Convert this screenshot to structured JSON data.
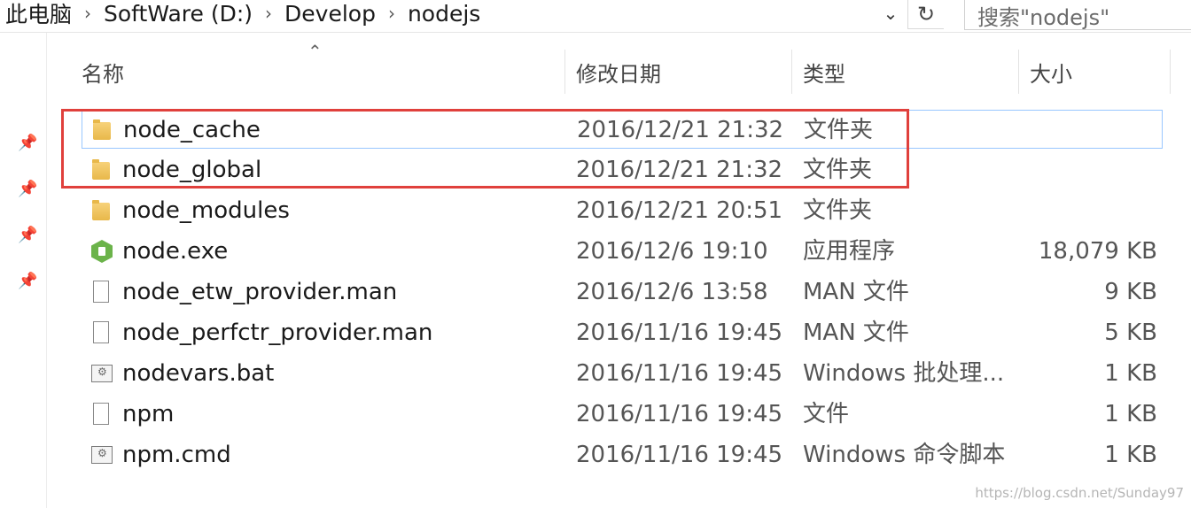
{
  "address_bar": {
    "crumbs": [
      "此电脑",
      "SoftWare (D:)",
      "Develop",
      "nodejs"
    ],
    "separator": "›"
  },
  "search": {
    "placeholder": "搜索\"nodejs\""
  },
  "columns": {
    "name": "名称",
    "date": "修改日期",
    "type": "类型",
    "size": "大小"
  },
  "files": [
    {
      "name": "node_cache",
      "date": "2016/12/21 21:32",
      "type": "文件夹",
      "size": "",
      "icon": "folder-icon"
    },
    {
      "name": "node_global",
      "date": "2016/12/21 21:32",
      "type": "文件夹",
      "size": "",
      "icon": "folder-icon"
    },
    {
      "name": "node_modules",
      "date": "2016/12/21 20:51",
      "type": "文件夹",
      "size": "",
      "icon": "folder-icon"
    },
    {
      "name": "node.exe",
      "date": "2016/12/6 19:10",
      "type": "应用程序",
      "size": "18,079 KB",
      "icon": "nodejs-app-icon"
    },
    {
      "name": "node_etw_provider.man",
      "date": "2016/12/6 13:58",
      "type": "MAN 文件",
      "size": "9 KB",
      "icon": "file-icon"
    },
    {
      "name": "node_perfctr_provider.man",
      "date": "2016/11/16 19:45",
      "type": "MAN 文件",
      "size": "5 KB",
      "icon": "file-icon"
    },
    {
      "name": "nodevars.bat",
      "date": "2016/11/16 19:45",
      "type": "Windows 批处理...",
      "size": "1 KB",
      "icon": "batch-file-icon"
    },
    {
      "name": "npm",
      "date": "2016/11/16 19:45",
      "type": "文件",
      "size": "1 KB",
      "icon": "file-icon"
    },
    {
      "name": "npm.cmd",
      "date": "2016/11/16 19:45",
      "type": "Windows 命令脚本",
      "size": "1 KB",
      "icon": "batch-file-icon"
    }
  ],
  "watermark": "https://blog.csdn.net/Sunday97",
  "colors": {
    "highlight_border": "#e0403c",
    "hover_border": "#99c7ff",
    "folder": "#e8b84a"
  }
}
